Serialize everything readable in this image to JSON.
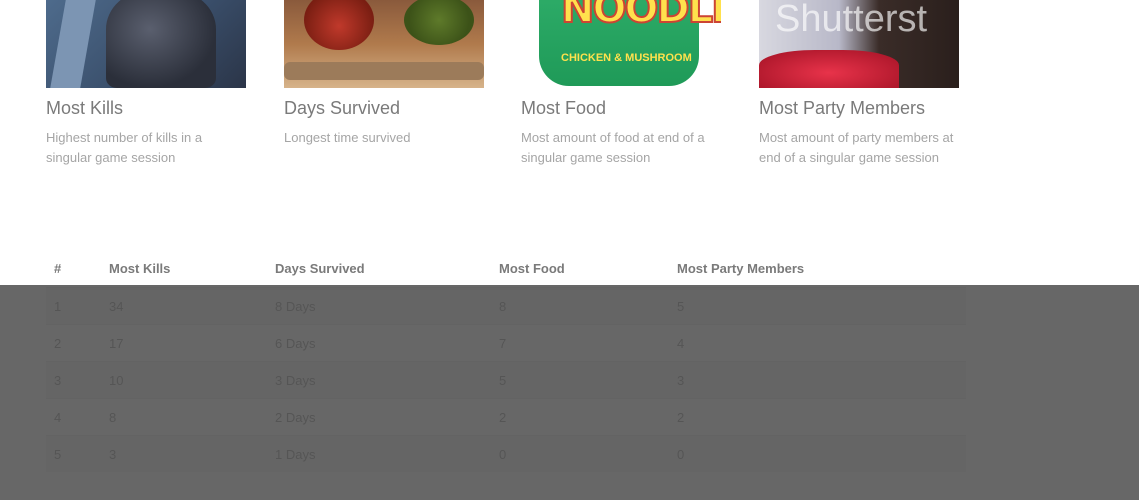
{
  "cards": [
    {
      "title": "Most Kills",
      "desc": "Highest number of kills in a singular game session",
      "image": "figure-photo"
    },
    {
      "title": "Days Survived",
      "desc": "Longest time survived",
      "image": "jungle-photo"
    },
    {
      "title": "Most Food",
      "desc": "Most amount of food at end of a singular game session",
      "image": "noodle-pot-photo",
      "logo_text": "NOODLE",
      "logo_sub": "CHICKEN & MUSHROOM"
    },
    {
      "title": "Most Party Members",
      "desc": "Most amount of party members at end of a singular game session",
      "image": "party-photo",
      "watermark": "Shutterst"
    }
  ],
  "table": {
    "headers": [
      "#",
      "Most Kills",
      "Days Survived",
      "Most Food",
      "Most Party Members"
    ],
    "rows": [
      [
        "1",
        "34",
        "8 Days",
        "8",
        "5"
      ],
      [
        "2",
        "17",
        "6 Days",
        "7",
        "4"
      ],
      [
        "3",
        "10",
        "3 Days",
        "5",
        "3"
      ],
      [
        "4",
        "8",
        "2 Days",
        "2",
        "2"
      ],
      [
        "5",
        "3",
        "1 Days",
        "0",
        "0"
      ]
    ]
  },
  "colors": {
    "overlay": "#464646",
    "title": "#7a7a7a",
    "desc": "#a5a5a5"
  }
}
